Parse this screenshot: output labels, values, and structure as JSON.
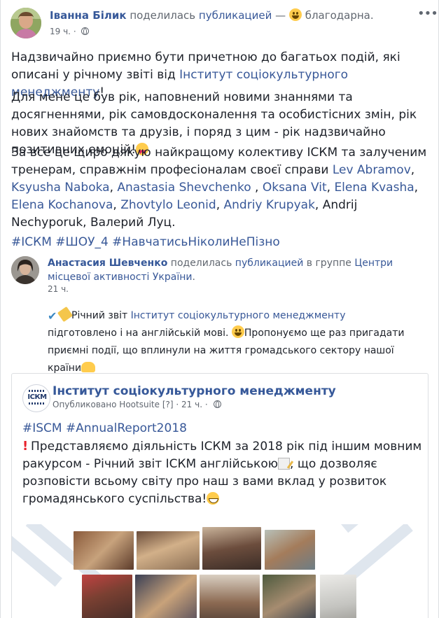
{
  "post": {
    "author": "Іванна Білик",
    "action": "поделилась",
    "object": "публикацией",
    "dash": "—",
    "feeling": "благодарна.",
    "time": "19 ч.",
    "dot": "·",
    "paragraphs": {
      "p1_text": "Надзвичайно приємно бути причетною до багатьох подій, які описані у річному звіті від ",
      "p1_link": "Інститут соціокультурного менеджменту",
      "p1_end": "!",
      "p2": "Для мене це був рік, наповнений новими знаннями та досягненнями, рік самовдосконалення та особистісних змін, рік нових знайомств та друзів, і поряд з цим - рік надзвичайно позитивних емоцій!",
      "p3_text": "За все це щиро дякую найкращому колективу ІСКМ та залученим тренерам, справжнім професіоналам своєї справи ",
      "tags": [
        "Lev Abramov",
        "Ksyusha Naboka",
        "Anastasia Shevchenko",
        "Oksana Vit",
        "Elena Kvasha",
        "Elena Kochanova",
        "Zhovtylo Leonid",
        "Andriy Krupyak"
      ],
      "sep_comma": ", ",
      "sep_space_comma": " , ",
      "p3_end": ", Andrij Nechyporuk, Валерий Луц."
    },
    "hashtags": [
      "#ІСКМ",
      "#ШОУ_4",
      "#НавчатисьНіколиНеПізно"
    ]
  },
  "shared": {
    "author": "Анастасия Шевченко",
    "action": "поделилась",
    "object": "публикацией",
    "in_group": "в группе",
    "group": "Центри місцевої активності України",
    "period": ".",
    "time": "21 ч.",
    "text_start": "Річний звіт ",
    "text_link": "Інститут соціокультурного менеджменту",
    "text_rest": " підготовлено і на англійській мові. ",
    "text_rest2": "Пропонуємо ще раз пригадати приємні події, що вплинули на життя громадського сектору нашої країни"
  },
  "card": {
    "logo_text": "ІСКМ",
    "name": "Інститут соціокультурного менеджменту",
    "published": "Опубликовано",
    "tool": "Hootsuite",
    "help": "[?]",
    "time": "21 ч.",
    "tags": "#ISCM #AnnualReport2018",
    "text1": "Представляємо діяльність ІСКМ за 2018 рік під іншим мовним ракурсом - Річний звіт ІСКМ англійською",
    "text2": ", що дозволяє розповісти всьому світу про наш з вами вклад у розвиток громадянського суспільства!"
  },
  "colors": {
    "link": "#385898",
    "author": "#365899",
    "text": "#1d2129",
    "meta": "#616770"
  },
  "icons": {
    "more": "more-horizontal-icon",
    "globe": "globe-icon",
    "feeling": "smiling-face-icon"
  }
}
